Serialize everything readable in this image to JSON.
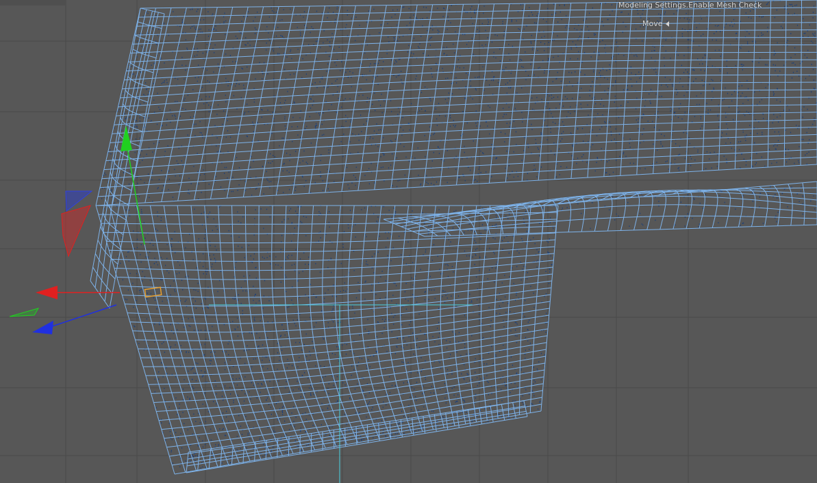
{
  "viewport": {
    "status_message": "Modeling Settings.Enable Mesh Check",
    "active_tool": "Move"
  },
  "colors": {
    "background": "#575757",
    "grid": "#4a4a4a",
    "grid_strong": "#444444",
    "wire": "#7eb3ea",
    "points": "#1a3f7a",
    "axis_x": "#e02020",
    "axis_y": "#20d020",
    "axis_z": "#2030e0",
    "world_axis_line": "#4ad1e0",
    "selection": "#e8a030"
  },
  "icons": {
    "gizmo": "move-gizmo-icon",
    "tool_indicator": "triangle-left-icon"
  }
}
